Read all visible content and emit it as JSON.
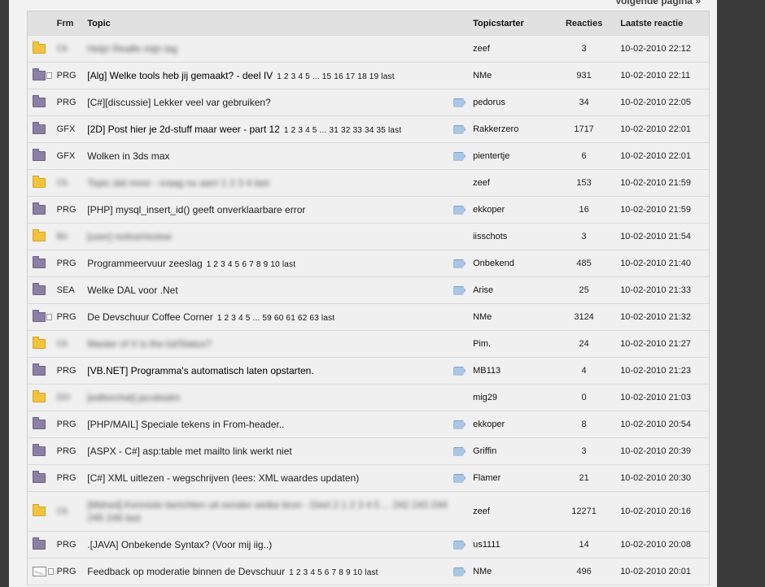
{
  "nav": {
    "next_page": "Volgende pagina »"
  },
  "headers": {
    "frm": "Frm",
    "topic": "Topic",
    "starter": "Topicstarter",
    "reacties": "Reacties",
    "laatste": "Laatste reactie"
  },
  "rows": [
    {
      "icon": "folder-yellow-icon",
      "frm": "Ck",
      "title": "Help! Realfe mijn lag",
      "pages": "",
      "tag": false,
      "starter": "zeef",
      "reacties": "3",
      "laatste": "10-02-2010 22:12",
      "blurred": true,
      "tall": false
    },
    {
      "icon": "folder-hot-icon",
      "frm": "PRG",
      "title": "[Alg] Welke tools heb jij gemaakt? - deel IV",
      "pages": "1 2 3 4 5 ... 15 16 17 18 19 last",
      "tag": false,
      "starter": "NMe",
      "reacties": "931",
      "laatste": "10-02-2010 22:11",
      "blurred": false,
      "unread": true,
      "tall": false
    },
    {
      "icon": "folder-purple-icon",
      "frm": "PRG",
      "title": "[C#][discussie] Lekker veel var gebruiken?",
      "pages": "",
      "tag": true,
      "starter": "pedorus",
      "reacties": "34",
      "laatste": "10-02-2010 22:05",
      "blurred": false,
      "tall": false
    },
    {
      "icon": "folder-purple-icon",
      "frm": "GFX",
      "title": "[2D] Post hier je 2d-stuff maar weer - part 12",
      "pages": "1 2 3 4 5 ... 31 32 33 34 35 last",
      "tag": true,
      "starter": "Rakkerzero",
      "reacties": "1717",
      "laatste": "10-02-2010 22:01",
      "blurred": false,
      "unread": true,
      "tall": false
    },
    {
      "icon": "folder-purple-icon",
      "frm": "GFX",
      "title": "Wolken in 3ds max",
      "pages": "",
      "tag": true,
      "starter": "pientertje",
      "reacties": "6",
      "laatste": "10-02-2010 22:01",
      "blurred": false,
      "tall": false
    },
    {
      "icon": "folder-yellow-icon",
      "frm": "Ck",
      "title": "Topic dat mooi - vraag nu aan! 1 2 3 4 last",
      "pages": "",
      "tag": false,
      "starter": "zeef",
      "reacties": "153",
      "laatste": "10-02-2010 21:59",
      "blurred": true,
      "tall": false
    },
    {
      "icon": "folder-purple-icon",
      "frm": "PRG",
      "title": "[PHP] mysql_insert_id() geeft onverklaarbare error",
      "pages": "",
      "tag": true,
      "starter": "ekkoper",
      "reacties": "16",
      "laatste": "10-02-2010 21:59",
      "blurred": false,
      "tall": false
    },
    {
      "icon": "folder-yellow-icon",
      "frm": "Bo",
      "title": "[user] notice/review",
      "pages": "",
      "tag": false,
      "starter": "iisschots",
      "reacties": "3",
      "laatste": "10-02-2010 21:54",
      "blurred": true,
      "tall": false
    },
    {
      "icon": "folder-purple-icon",
      "frm": "PRG",
      "title": "Programmeervuur zeeslag",
      "pages": "1 2 3 4 5 6 7 8 9 10 last",
      "tag": true,
      "starter": "Onbekend",
      "reacties": "485",
      "laatste": "10-02-2010 21:40",
      "blurred": false,
      "tall": false
    },
    {
      "icon": "folder-purple-icon",
      "frm": "SEA",
      "title": "Welke DAL voor .Net",
      "pages": "",
      "tag": true,
      "starter": "Arise",
      "reacties": "25",
      "laatste": "10-02-2010 21:33",
      "blurred": false,
      "tall": false
    },
    {
      "icon": "folder-hot-icon",
      "frm": "PRG",
      "title": "De Devschuur Coffee Corner",
      "pages": "1 2 3 4 5 ... 59 60 61 62 63 last",
      "tag": false,
      "starter": "NMe",
      "reacties": "3124",
      "laatste": "10-02-2010 21:32",
      "blurred": false,
      "tall": false
    },
    {
      "icon": "folder-yellow-icon",
      "frm": "Ck",
      "title": "Master of V is the lol/Status?",
      "pages": "",
      "tag": false,
      "starter": "Pim.",
      "reacties": "24",
      "laatste": "10-02-2010 21:27",
      "blurred": true,
      "tall": false
    },
    {
      "icon": "folder-purple-icon",
      "frm": "PRG",
      "title": "[VB.NET] Programma's automatisch laten opstarten.",
      "pages": "",
      "tag": true,
      "starter": "MB113",
      "reacties": "4",
      "laatste": "10-02-2010 21:23",
      "blurred": false,
      "unread": true,
      "tall": false
    },
    {
      "icon": "folder-yellow-icon",
      "frm": "DO",
      "title": "[editorchat] jacobsdm",
      "pages": "",
      "tag": false,
      "starter": "mig29",
      "reacties": "0",
      "laatste": "10-02-2010 21:03",
      "blurred": true,
      "tall": false
    },
    {
      "icon": "folder-purple-icon",
      "frm": "PRG",
      "title": "[PHP/MAIL] Speciale tekens in From-header..",
      "pages": "",
      "tag": true,
      "starter": "ekkoper",
      "reacties": "8",
      "laatste": "10-02-2010 20:54",
      "blurred": false,
      "tall": false
    },
    {
      "icon": "folder-purple-icon",
      "frm": "PRG",
      "title": "[ASPX - C#] asp:table met mailto link werkt niet",
      "pages": "",
      "tag": true,
      "starter": "Griffin",
      "reacties": "3",
      "laatste": "10-02-2010 20:39",
      "blurred": false,
      "tall": false
    },
    {
      "icon": "folder-purple-icon",
      "frm": "PRG",
      "title": "[C#] XML uitlezen - wegschrijven (lees: XML waardes updaten)",
      "pages": "",
      "tag": true,
      "starter": "Flamer",
      "reacties": "21",
      "laatste": "10-02-2010 20:30",
      "blurred": false,
      "tall": false
    },
    {
      "icon": "folder-yellow-icon",
      "frm": "Ck",
      "title": "[Mdrwd] Kenniste berichten uit eender welke bron - Deel 2 1 2 3 4 5 ... 242 243 244 245 246 last",
      "pages": "",
      "tag": false,
      "starter": "zeef",
      "reacties": "12271",
      "laatste": "10-02-2010 20:16",
      "blurred": true,
      "tall": true
    },
    {
      "icon": "folder-purple-icon",
      "frm": "PRG",
      "title": ".[JAVA] Onbekende Syntax? (Voor mij iig..)",
      "pages": "",
      "tag": true,
      "starter": "us1111",
      "reacties": "14",
      "laatste": "10-02-2010 20:08",
      "blurred": false,
      "tall": false
    },
    {
      "icon": "envelope-icon",
      "frm": "PRG",
      "title": "Feedback op moderatie binnen de Devschuur",
      "pages": "1 2 3 4 5 6 7 8 9 10 last",
      "tag": true,
      "starter": "NMe",
      "reacties": "496",
      "laatste": "10-02-2010 20:01",
      "blurred": false,
      "tall": false
    }
  ]
}
